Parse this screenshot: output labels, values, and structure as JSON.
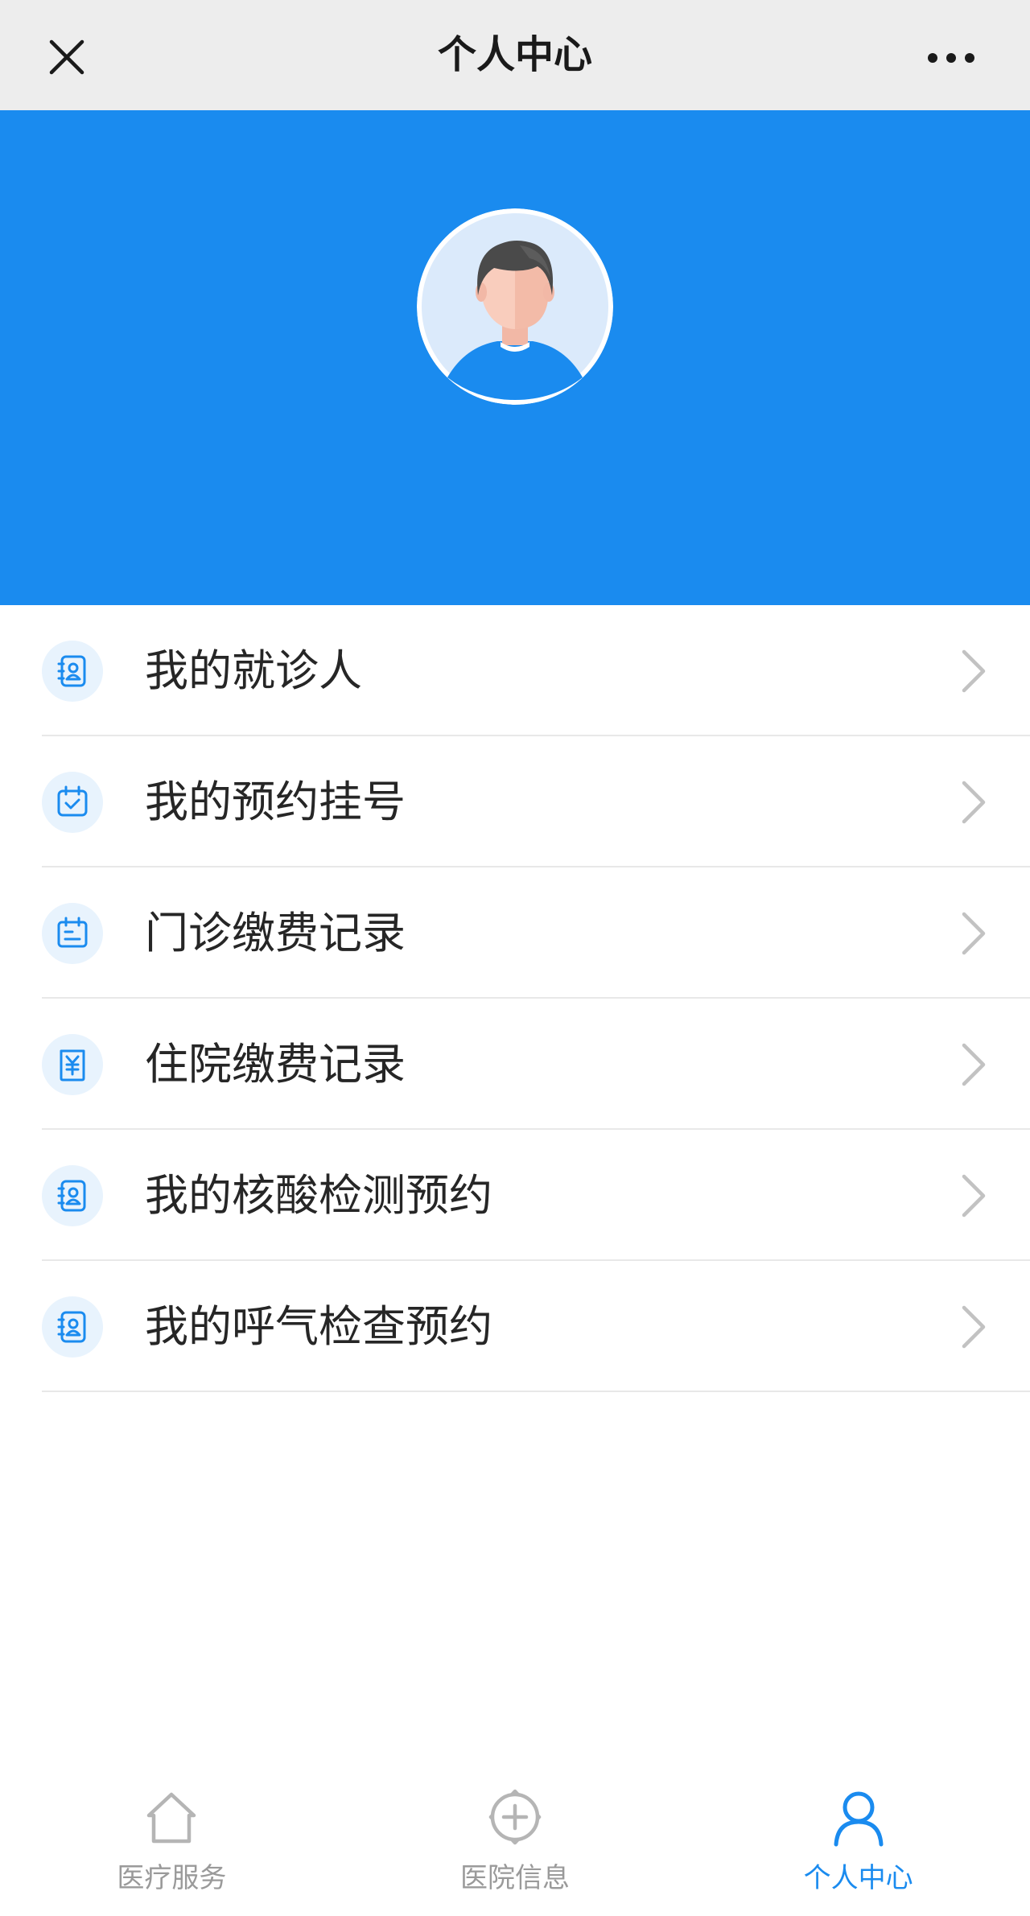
{
  "navbar": {
    "title": "个人中心",
    "close_icon": "close-icon",
    "more_icon": "more-dots-icon"
  },
  "colors": {
    "brand_blue": "#1a8bef",
    "navbar_bg": "#ededed",
    "icon_bg": "#e8f3fd",
    "tab_inactive": "#9a9a9a"
  },
  "profile": {
    "avatar_icon": "user-avatar-icon"
  },
  "menu": {
    "items": [
      {
        "label": "我的就诊人",
        "icon": "patient-card-icon"
      },
      {
        "label": "我的预约挂号",
        "icon": "calendar-check-icon"
      },
      {
        "label": "门诊缴费记录",
        "icon": "calendar-list-icon"
      },
      {
        "label": "住院缴费记录",
        "icon": "yuan-receipt-icon"
      },
      {
        "label": "我的核酸检测预约",
        "icon": "patient-card-icon"
      },
      {
        "label": "我的呼气检查预约",
        "icon": "patient-card-icon"
      }
    ]
  },
  "tabbar": {
    "items": [
      {
        "label": "医疗服务",
        "icon": "home-icon",
        "active": false
      },
      {
        "label": "医院信息",
        "icon": "plus-shield-icon",
        "active": false
      },
      {
        "label": "个人中心",
        "icon": "person-icon",
        "active": true
      }
    ]
  }
}
